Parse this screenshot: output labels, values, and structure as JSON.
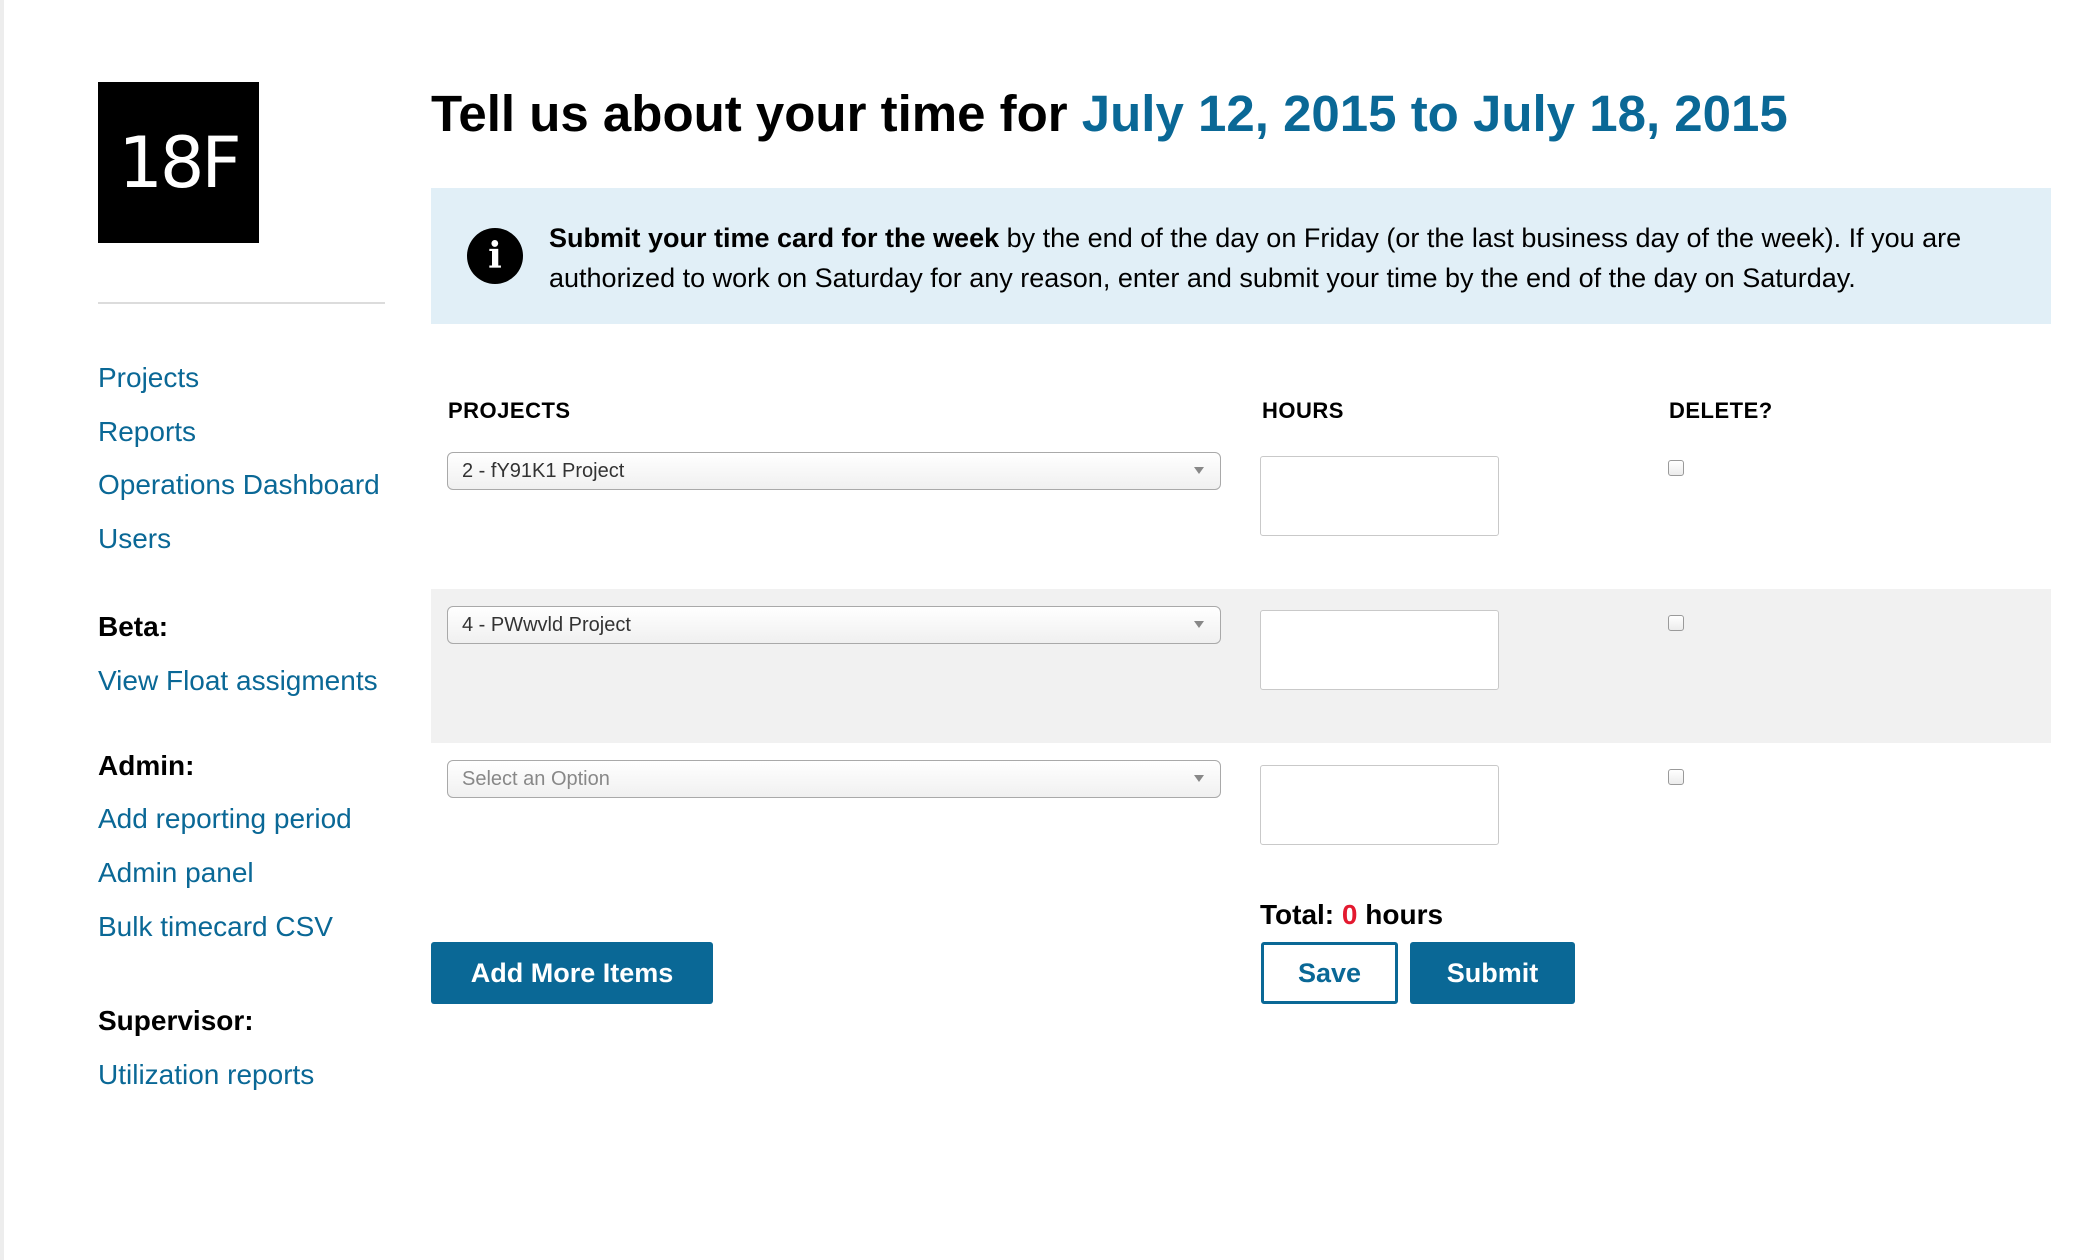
{
  "sidebar": {
    "logo_text": "18F",
    "main_links": [
      "Projects",
      "Reports",
      "Operations Dashboard",
      "Users"
    ],
    "beta_heading": "Beta:",
    "beta_links": [
      "View Float assigments"
    ],
    "admin_heading": "Admin:",
    "admin_links": [
      "Add reporting period",
      "Admin panel",
      "Bulk timecard CSV"
    ],
    "supervisor_heading": "Supervisor:",
    "supervisor_links": [
      "Utilization reports"
    ]
  },
  "header": {
    "title_prefix": "Tell us about your time for",
    "date_range": "July 12, 2015 to July 18, 2015"
  },
  "alert": {
    "icon": "info-circle-icon",
    "bold_text": "Submit your time card for the week",
    "text": " by the end of the day on Friday (or the last business day of the week). If you are authorized to work on Saturday for any reason, enter and submit your time by the end of the day on Saturday."
  },
  "table": {
    "headers": {
      "projects": "PROJECTS",
      "hours": "HOURS",
      "delete": "DELETE?"
    },
    "rows": [
      {
        "project": "2 - fY91K1 Project",
        "hours": "",
        "delete": false
      },
      {
        "project": "4 - PWwvld Project",
        "hours": "",
        "delete": false
      },
      {
        "project": "Select an Option",
        "hours": "",
        "delete": false
      }
    ]
  },
  "total": {
    "label": "Total:",
    "value": "0",
    "unit": "hours"
  },
  "buttons": {
    "add_more": "Add More Items",
    "save": "Save",
    "submit": "Submit"
  },
  "colors": {
    "link": "#0a6896",
    "primary_button": "#0a6896",
    "alert_bg": "#e1eff7",
    "total_number": "#e3192f"
  }
}
